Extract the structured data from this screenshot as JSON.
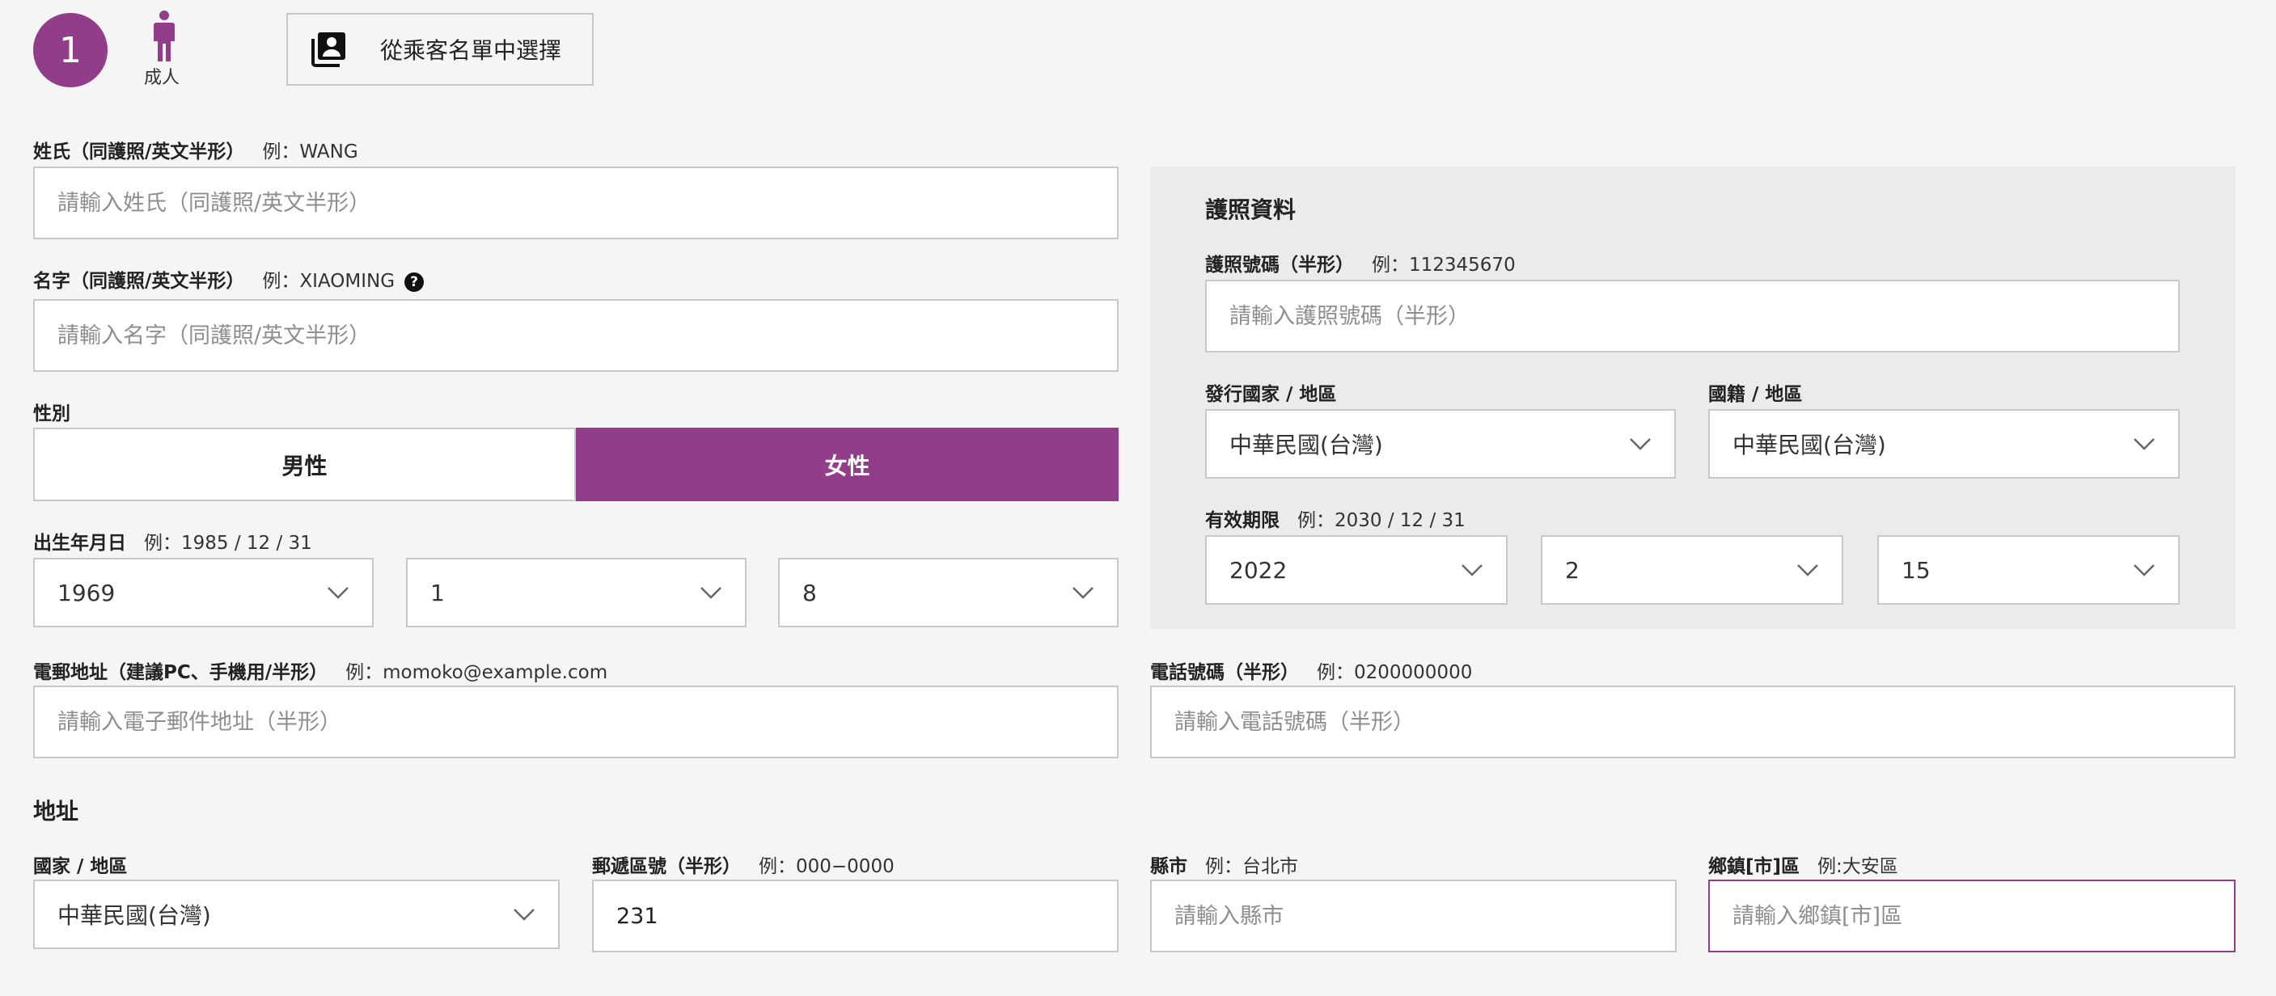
{
  "passenger": {
    "number": "1",
    "type_label": "成人",
    "select_from_list_label": "從乘客名單中選擇"
  },
  "surname": {
    "label": "姓氏（同護照/英文半形）",
    "hint": "例：WANG",
    "placeholder": "請輸入姓氏（同護照/英文半形）",
    "value": ""
  },
  "given_name": {
    "label": "名字（同護照/英文半形）",
    "hint": "例：XIAOMING",
    "help_icon": "?",
    "placeholder": "請輸入名字（同護照/英文半形）",
    "value": ""
  },
  "gender": {
    "label": "性別",
    "options": [
      "男性",
      "女性"
    ],
    "selected": "女性"
  },
  "birth_date": {
    "label": "出生年月日",
    "hint": "例：1985 / 12 / 31",
    "year": "1969",
    "month": "1",
    "day": "8"
  },
  "passport": {
    "section_title": "護照資料",
    "number_label": "護照號碼（半形）",
    "number_hint": "例：112345670",
    "number_placeholder": "請輸入護照號碼（半形）",
    "issuing_country_label": "發行國家 / 地區",
    "issuing_country_value": "中華民國(台灣)",
    "nationality_label": "國籍 / 地區",
    "nationality_value": "中華民國(台灣)",
    "expiry_label": "有效期限",
    "expiry_hint": "例：2030 / 12 / 31",
    "expiry_year": "2022",
    "expiry_month": "2",
    "expiry_day": "15"
  },
  "email": {
    "label": "電郵地址（建議PC、手機用/半形）",
    "hint": "例：momoko@example.com",
    "placeholder": "請輸入電子郵件地址（半形）",
    "value": ""
  },
  "phone": {
    "label": "電話號碼（半形）",
    "hint": "例：0200000000",
    "placeholder": "請輸入電話號碼（半形）",
    "value": ""
  },
  "address": {
    "section_title": "地址",
    "country_label": "國家 / 地區",
    "country_value": "中華民國(台灣)",
    "postal_label": "郵遞區號（半形）",
    "postal_hint": "例：000−0000",
    "postal_value": "231",
    "city_label": "縣市",
    "city_hint": "例：台北市",
    "city_placeholder": "請輸入縣市",
    "district_label": "鄉鎮[市]區",
    "district_hint": "例:大安區",
    "district_placeholder": "請輸入鄉鎮[市]區"
  },
  "colors": {
    "accent": "#913d8a",
    "border": "#c8c8c8",
    "panel_bg": "#ebebeb",
    "page_bg": "#f5f5f5"
  }
}
